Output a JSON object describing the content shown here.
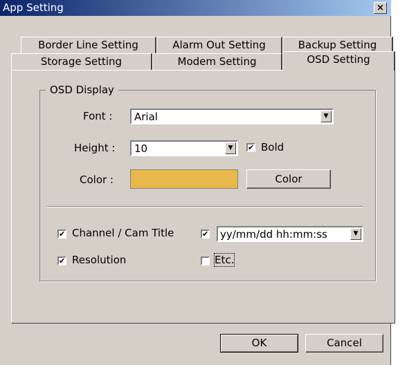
{
  "window": {
    "title": "App Setting",
    "close_glyph": "×"
  },
  "tabs": {
    "row1": [
      "Border Line Setting",
      "Alarm Out Setting",
      "Backup Setting"
    ],
    "row2": [
      "Storage Setting",
      "Modem Setting",
      "OSD Setting"
    ],
    "active": "OSD Setting"
  },
  "osd": {
    "group_label": "OSD Display",
    "font": {
      "label": "Font :",
      "value": "Arial"
    },
    "height": {
      "label": "Height :",
      "value": "10"
    },
    "bold": {
      "label": "Bold",
      "checked": true
    },
    "color": {
      "label": "Color :",
      "swatch": "#e8b84a",
      "button_label": "Color"
    },
    "channel_title": {
      "label": "Channel / Cam Title",
      "checked": true
    },
    "date_format": {
      "checked": true,
      "value": "yy/mm/dd hh:mm:ss"
    },
    "resolution": {
      "label": "Resolution",
      "checked": true
    },
    "etc": {
      "label": "Etc.",
      "checked": false
    }
  },
  "footer": {
    "ok_label": "OK",
    "cancel_label": "Cancel"
  },
  "icons": {
    "checkmark": "✔",
    "dropdown_arrow": "▼"
  }
}
